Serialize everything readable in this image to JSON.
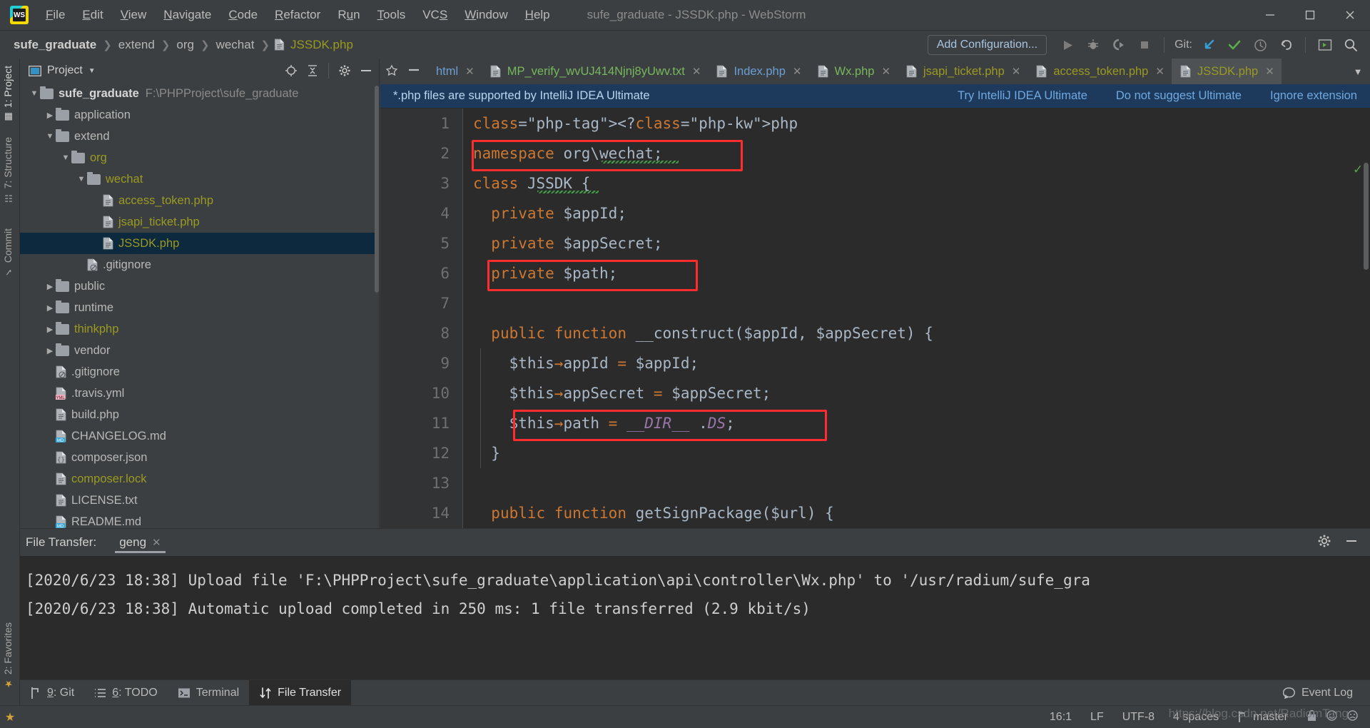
{
  "window": {
    "title": "sufe_graduate - JSSDK.php - WebStorm",
    "logo_text": "WS",
    "minimize": "minimize-icon",
    "maximize": "maximize-icon",
    "close": "close-icon"
  },
  "menu": [
    {
      "label": "File",
      "mnemonic": "F"
    },
    {
      "label": "Edit",
      "mnemonic": "E"
    },
    {
      "label": "View",
      "mnemonic": "V"
    },
    {
      "label": "Navigate",
      "mnemonic": "N"
    },
    {
      "label": "Code",
      "mnemonic": "C"
    },
    {
      "label": "Refactor",
      "mnemonic": "R"
    },
    {
      "label": "Run",
      "mnemonic": "u"
    },
    {
      "label": "Tools",
      "mnemonic": "T"
    },
    {
      "label": "VCS",
      "mnemonic": "S"
    },
    {
      "label": "Window",
      "mnemonic": "W"
    },
    {
      "label": "Help",
      "mnemonic": "H"
    }
  ],
  "breadcrumb": [
    {
      "label": "sufe_graduate",
      "type": "project"
    },
    {
      "label": "extend",
      "type": "folder"
    },
    {
      "label": "org",
      "type": "folder"
    },
    {
      "label": "wechat",
      "type": "folder"
    },
    {
      "label": "JSSDK.php",
      "type": "file"
    }
  ],
  "toolbar": {
    "add_configuration": "Add Configuration...",
    "run": "run-icon",
    "debug": "debug-icon",
    "run_coverage": "run-with-coverage-icon",
    "stop": "stop-icon",
    "git_label": "Git:",
    "git_update": "update-project-icon",
    "git_commit": "commit-icon",
    "git_history": "history-icon",
    "git_rollback": "rollback-icon",
    "search_everywhere": "search-icon",
    "terminal_toggle": "terminal-icon"
  },
  "left_strip": [
    {
      "label": "1: Project",
      "icon": "project-icon",
      "active": true
    },
    {
      "label": "7: Structure",
      "icon": "structure-icon",
      "active": false
    },
    {
      "label": "Commit",
      "icon": "commit-icon",
      "active": false
    }
  ],
  "left_strip_bottom": [
    {
      "label": "2: Favorites",
      "icon": "star-icon"
    }
  ],
  "project_panel": {
    "title": "Project",
    "caret": "chevron-down-icon",
    "icons": [
      "locate-icon",
      "collapse-all-icon",
      "gear-icon",
      "hide-icon"
    ],
    "tree": [
      {
        "indent": 0,
        "arrow": "down",
        "icon": "folder",
        "name": "sufe_graduate",
        "path": "F:\\PHPProject\\sufe_graduate",
        "style": "project",
        "selected": false
      },
      {
        "indent": 1,
        "arrow": "right",
        "icon": "folder",
        "name": "application",
        "path": "",
        "style": "gray",
        "selected": false
      },
      {
        "indent": 1,
        "arrow": "down",
        "icon": "folder",
        "name": "extend",
        "path": "",
        "style": "gray",
        "selected": false
      },
      {
        "indent": 2,
        "arrow": "down",
        "icon": "folder",
        "name": "org",
        "path": "",
        "style": "yellow",
        "selected": false
      },
      {
        "indent": 3,
        "arrow": "down",
        "icon": "folder",
        "name": "wechat",
        "path": "",
        "style": "yellow",
        "selected": false
      },
      {
        "indent": 4,
        "arrow": "none",
        "icon": "php",
        "name": "access_token.php",
        "path": "",
        "style": "yellow",
        "selected": false
      },
      {
        "indent": 4,
        "arrow": "none",
        "icon": "php",
        "name": "jsapi_ticket.php",
        "path": "",
        "style": "yellow",
        "selected": false
      },
      {
        "indent": 4,
        "arrow": "none",
        "icon": "php",
        "name": "JSSDK.php",
        "path": "",
        "style": "yellow",
        "selected": true
      },
      {
        "indent": 3,
        "arrow": "none",
        "icon": "ignore",
        "name": ".gitignore",
        "path": "",
        "style": "gray",
        "selected": false
      },
      {
        "indent": 1,
        "arrow": "right",
        "icon": "folder",
        "name": "public",
        "path": "",
        "style": "gray",
        "selected": false
      },
      {
        "indent": 1,
        "arrow": "right",
        "icon": "folder",
        "name": "runtime",
        "path": "",
        "style": "gray",
        "selected": false
      },
      {
        "indent": 1,
        "arrow": "right",
        "icon": "folder",
        "name": "thinkphp",
        "path": "",
        "style": "yellow",
        "selected": false
      },
      {
        "indent": 1,
        "arrow": "right",
        "icon": "folder",
        "name": "vendor",
        "path": "",
        "style": "gray",
        "selected": false
      },
      {
        "indent": 1,
        "arrow": "none",
        "icon": "ignore",
        "name": ".gitignore",
        "path": "",
        "style": "gray",
        "selected": false
      },
      {
        "indent": 1,
        "arrow": "none",
        "icon": "yml",
        "name": ".travis.yml",
        "path": "",
        "style": "gray",
        "selected": false
      },
      {
        "indent": 1,
        "arrow": "none",
        "icon": "php",
        "name": "build.php",
        "path": "",
        "style": "gray",
        "selected": false
      },
      {
        "indent": 1,
        "arrow": "none",
        "icon": "md",
        "name": "CHANGELOG.md",
        "path": "",
        "style": "gray",
        "selected": false
      },
      {
        "indent": 1,
        "arrow": "none",
        "icon": "json",
        "name": "composer.json",
        "path": "",
        "style": "gray",
        "selected": false
      },
      {
        "indent": 1,
        "arrow": "none",
        "icon": "php",
        "name": "composer.lock",
        "path": "",
        "style": "yellow",
        "selected": false
      },
      {
        "indent": 1,
        "arrow": "none",
        "icon": "txt",
        "name": "LICENSE.txt",
        "path": "",
        "style": "gray",
        "selected": false
      },
      {
        "indent": 1,
        "arrow": "none",
        "icon": "md",
        "name": "README.md",
        "path": "",
        "style": "gray",
        "selected": false
      }
    ]
  },
  "editor_tabs": {
    "left_icons": [
      "expand-entry-points-icon",
      "sort-icon"
    ],
    "tabs": [
      {
        "label": "html",
        "color": "blue",
        "icon": "none",
        "active": false
      },
      {
        "label": "MP_verify_wvUJ414Njnj8yUwv.txt",
        "color": "green",
        "icon": "file",
        "active": false
      },
      {
        "label": "Index.php",
        "color": "blue",
        "icon": "file",
        "active": false
      },
      {
        "label": "Wx.php",
        "color": "green",
        "icon": "file",
        "active": false
      },
      {
        "label": "jsapi_ticket.php",
        "color": "yellow",
        "icon": "file",
        "active": false
      },
      {
        "label": "access_token.php",
        "color": "yellow",
        "icon": "file",
        "active": false
      },
      {
        "label": "JSSDK.php",
        "color": "yellow",
        "icon": "file",
        "active": true
      }
    ],
    "overflow": "chevron-down-icon"
  },
  "notification": {
    "message": "*.php files are supported by IntelliJ IDEA Ultimate",
    "actions": [
      "Try IntelliJ IDEA Ultimate",
      "Do not suggest Ultimate",
      "Ignore extension"
    ]
  },
  "code": {
    "lines": [
      {
        "n": "1",
        "text": "<?php"
      },
      {
        "n": "2",
        "text": "namespace org\\wechat;"
      },
      {
        "n": "3",
        "text": "class JSSDK {"
      },
      {
        "n": "4",
        "text": "  private $appId;"
      },
      {
        "n": "5",
        "text": "  private $appSecret;"
      },
      {
        "n": "6",
        "text": "  private $path;"
      },
      {
        "n": "7",
        "text": ""
      },
      {
        "n": "8",
        "text": "  public function __construct($appId, $appSecret) {"
      },
      {
        "n": "9",
        "text": "    $this->appId = $appId;"
      },
      {
        "n": "10",
        "text": "    $this->appSecret = $appSecret;"
      },
      {
        "n": "11",
        "text": "    $this->path = __DIR__ .DS;"
      },
      {
        "n": "12",
        "text": "  }"
      },
      {
        "n": "13",
        "text": ""
      },
      {
        "n": "14",
        "text": "  public function getSignPackage($url) {"
      }
    ]
  },
  "file_transfer": {
    "title": "File Transfer:",
    "tab": "geng",
    "tab_close": "close-icon",
    "gear": "gear-icon",
    "hide": "hide-icon",
    "console": [
      "[2020/6/23 18:38] Upload file 'F:\\PHPProject\\sufe_graduate\\application\\api\\controller\\Wx.php' to '/usr/radium/sufe_gra",
      "[2020/6/23 18:38] Automatic upload completed in 250 ms: 1 file transferred (2.9 kbit/s)"
    ]
  },
  "bottom_bar": {
    "items": [
      {
        "label": "9: Git",
        "num": "9",
        "rest": ": Git",
        "icon": "git-branch-icon",
        "active": false
      },
      {
        "label": "6: TODO",
        "num": "6",
        "rest": ": TODO",
        "icon": "todo-list-icon",
        "active": false
      },
      {
        "label": "Terminal",
        "num": "",
        "rest": "Terminal",
        "icon": "terminal-icon",
        "active": false
      },
      {
        "label": "File Transfer",
        "num": "",
        "rest": "File Transfer",
        "icon": "transfer-icon",
        "active": true
      }
    ],
    "event_log": "Event Log",
    "event_log_icon": "balloon-icon"
  },
  "status_bar": {
    "caret_position": "16:1",
    "line_separator": "LF",
    "encoding": "UTF-8",
    "indent": "4 spaces",
    "branch": "master",
    "branch_icon": "git-branch-icon",
    "icons": [
      "lock-icon",
      "inspection-icon",
      "notifications-icon"
    ]
  },
  "watermark": "https://blog.csdn.net/RadiomTang",
  "colors": {
    "accent_blue": "#6a9fd4",
    "php_yellow": "#9a9a22",
    "green": "#76b85c",
    "highlight_red": "#ff2d2d",
    "selection": "#0d293e",
    "editor_bg": "#2b2b2b",
    "panel_bg": "#3c3f41"
  }
}
